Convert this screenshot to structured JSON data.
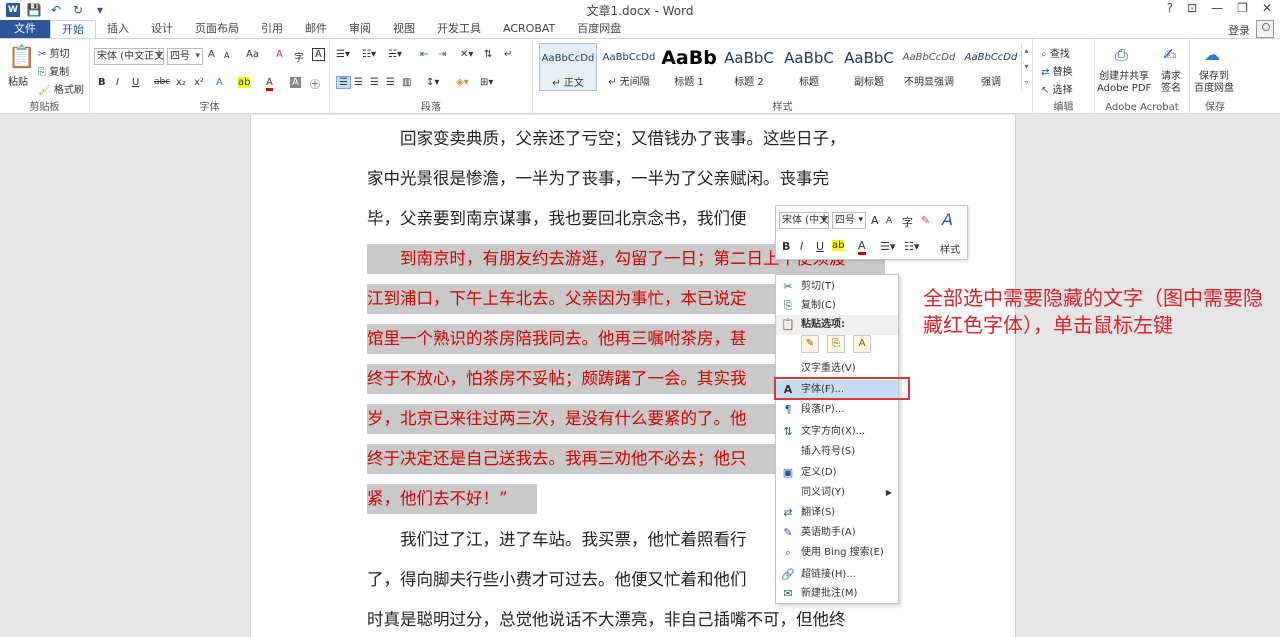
{
  "window": {
    "title": "文章1.docx - Word",
    "controls": [
      "?",
      "⊡",
      "—",
      "❐",
      "✕"
    ],
    "login": "登录"
  },
  "qat": {
    "logo": "W",
    "save": "💾",
    "undo": "↶",
    "redo": "↻",
    "more": "▾"
  },
  "tabs": [
    "文件",
    "开始",
    "插入",
    "设计",
    "页面布局",
    "引用",
    "邮件",
    "审阅",
    "视图",
    "开发工具",
    "ACROBAT",
    "百度网盘"
  ],
  "ribbon": {
    "clipboard": {
      "label": "剪贴板",
      "paste": "粘贴",
      "cut": "剪切",
      "copy": "复制",
      "format_painter": "格式刷"
    },
    "font": {
      "label": "字体",
      "font_name": "宋体 (中文正文)",
      "font_size": "四号",
      "grow": "A",
      "shrink": "A",
      "case": "Aa",
      "clear": "A",
      "phonetic": "字",
      "border": "A",
      "bold": "B",
      "italic": "I",
      "underline": "U",
      "strike": "abc",
      "sub": "x₂",
      "sup": "x²",
      "effects": "A",
      "highlight": "ab",
      "color": "A",
      "shading": "A",
      "circle": "㊉"
    },
    "paragraph": {
      "label": "段落"
    },
    "styles": {
      "label": "样式",
      "items": [
        {
          "sample": "AaBbCcDd",
          "name": "↵ 正文"
        },
        {
          "sample": "AaBbCcDd",
          "name": "↵ 无间隔"
        },
        {
          "sample": "AaBb",
          "name": "标题 1"
        },
        {
          "sample": "AaBbC",
          "name": "标题 2"
        },
        {
          "sample": "AaBbC",
          "name": "标题"
        },
        {
          "sample": "AaBbC",
          "name": "副标题"
        },
        {
          "sample": "AaBbCcDd",
          "name": "不明显强调"
        },
        {
          "sample": "AaBbCcDd",
          "name": "强调"
        }
      ]
    },
    "editing": {
      "label": "编辑",
      "find": "查找",
      "replace": "替换",
      "select": "选择"
    },
    "acrobat": {
      "label": "Adobe Acrobat",
      "create": "创建并共享\nAdobe PDF",
      "sign": "请求\n签名"
    },
    "save": {
      "label": "保存",
      "save_baidu": "保存到\n百度网盘"
    }
  },
  "document": {
    "lines": [
      "　　回家变卖典质，父亲还了亏空；又借钱办了丧事。这些日子，",
      "家中光景很是惨澹，一半为了丧事，一半为了父亲赋闲。丧事完",
      "毕，父亲要到南京谋事，我也要回北京念书，我们便"
    ],
    "selected_lines": [
      "　　到南京时，有朋友约去游逛，勾留了一日；第二日上午便须渡",
      "江到浦口，下午上车北去。父亲因为事忙，本已说定",
      "馆里一个熟识的茶房陪我同去。他再三嘱咐茶房，甚",
      "终于不放心，怕茶房不妥帖；颇踌躇了一会。其实我",
      "岁，北京已来往过两三次，是没有什么要紧的了。他",
      "终于决定还是自己送我去。我再三劝他不必去；他只",
      "紧，他们去不好！”"
    ],
    "after_lines": [
      "　　我们过了江，进了车站。我买票，他忙着照看行",
      "了，得向脚夫行些小费才可过去。他便又忙着和他们",
      "时真是聪明过分，总觉他说话不大漂亮，非自己插嘴不可，但他终"
    ]
  },
  "minibar": {
    "font": "宋体 (中文)",
    "size": "四号",
    "style": "样式"
  },
  "context_menu": {
    "items": [
      {
        "icon": "✂",
        "label": "剪切(T)"
      },
      {
        "icon": "⎘",
        "label": "复制(C)"
      },
      {
        "icon": "📋",
        "label": "粘贴选项:"
      },
      {
        "icon": "",
        "label": "汉字重选(V)"
      },
      {
        "icon": "A",
        "label": "字体(F)..."
      },
      {
        "icon": "¶",
        "label": "段落(P)..."
      },
      {
        "icon": "⇅",
        "label": "文字方向(X)..."
      },
      {
        "icon": "",
        "label": "插入符号(S)"
      },
      {
        "icon": "▣",
        "label": "定义(D)"
      },
      {
        "icon": "",
        "label": "同义词(Y)"
      },
      {
        "icon": "⇄",
        "label": "翻译(S)"
      },
      {
        "icon": "✎",
        "label": "英语助手(A)"
      },
      {
        "icon": "⌕",
        "label": "使用 Bing 搜索(E)"
      },
      {
        "icon": "🔗",
        "label": "超链接(H)..."
      },
      {
        "icon": "✉",
        "label": "新建批注(M)"
      }
    ]
  },
  "annotation": "全部选中需要隐藏的文字（图中需要隐藏红色字体），单击鼠标左键",
  "colors": {
    "word_blue": "#2b579a",
    "selection_text": "#d40000",
    "annotation": "#e0202a"
  }
}
